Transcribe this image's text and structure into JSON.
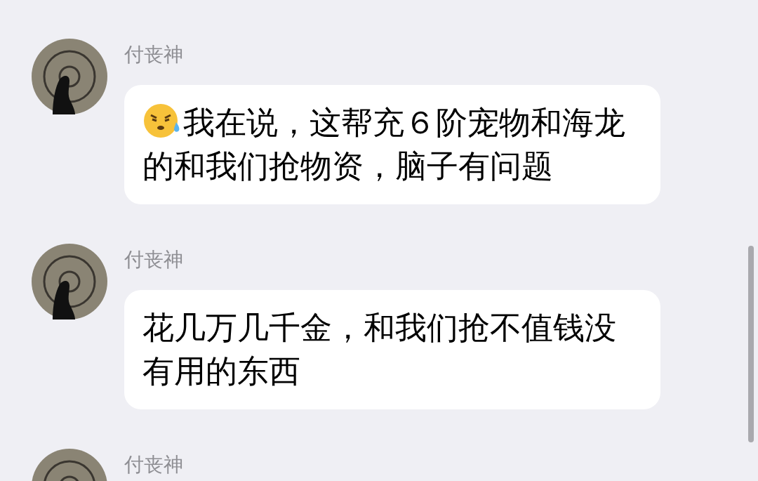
{
  "messages": [
    {
      "sender": "付丧神",
      "emoji": true,
      "text": "我在说，这帮充６阶宠物和海龙的和我们抢物资，脑子有问题"
    },
    {
      "sender": "付丧神",
      "emoji": false,
      "text": "花几万几千金，和我们抢不值钱没有用的东西"
    },
    {
      "sender": "付丧神"
    }
  ]
}
